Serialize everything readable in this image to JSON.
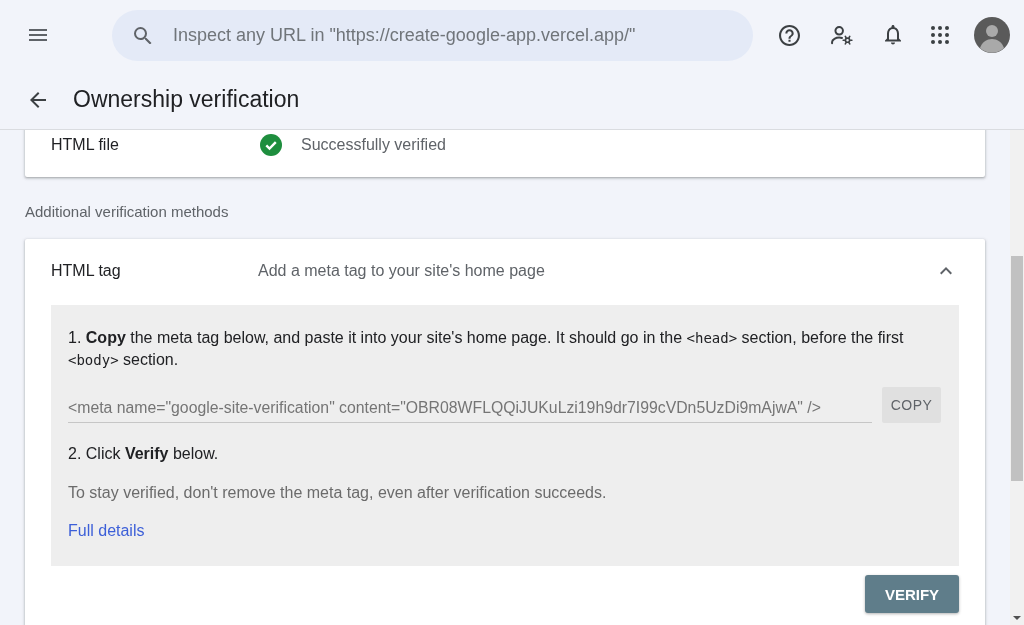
{
  "top_bar": {
    "search": {
      "placeholder": "Inspect any URL in \"https://create-google-app.vercel.app/\""
    }
  },
  "page_header": {
    "title": "Ownership verification"
  },
  "verified_method": {
    "name": "HTML file",
    "status": "Successfully verified",
    "verified": true
  },
  "additional_methods": {
    "heading": "Additional verification methods",
    "methods": [
      {
        "name": "HTML tag",
        "description": "Add a meta tag to your site's home page",
        "expanded": true,
        "instruction": [
          {
            "kind": "rich",
            "text": "1. **Copy** the meta tag below, and paste it into your site's home page. It should go in the "
          },
          {
            "kind": "code",
            "text": "<head>"
          },
          {
            "kind": "rich",
            "text": " section, before the first "
          },
          {
            "kind": "code",
            "text": "<body>"
          },
          {
            "kind": "rich",
            "text": " section."
          }
        ],
        "meta_tag_field": {
          "value": "<meta name=\"google-site-verification\" content=\"OBR08WFLQQiJUKuLzi19h9dr7I99cVDn5UzDi9mAjwA\" />"
        },
        "copy_button": "COPY",
        "step_2": "2. Click **Verify** below.",
        "note": "To stay verified, don't remove the meta tag, even after verification succeeds.",
        "link": "Full details",
        "verify_button": "VERIFY"
      }
    ]
  }
}
